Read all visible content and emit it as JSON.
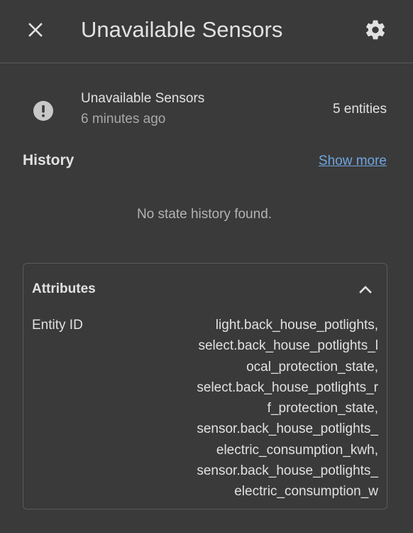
{
  "dialog": {
    "title": "Unavailable Sensors",
    "close_icon": "close-icon",
    "settings_icon": "gear-icon"
  },
  "entity": {
    "icon": "alert-circle-icon",
    "name": "Unavailable Sensors",
    "time": "6 minutes ago",
    "state": "5 entities"
  },
  "history": {
    "title": "History",
    "show_more": "Show more",
    "empty": "No state history found."
  },
  "attributes": {
    "title": "Attributes",
    "chevron_icon": "chevron-up-icon",
    "row": {
      "key": "Entity ID",
      "value_lines": [
        "light.back_house_potlights,",
        "select.back_house_potlights_l",
        "ocal_protection_state,",
        "select.back_house_potlights_r",
        "f_protection_state,",
        "sensor.back_house_potlights_",
        "electric_consumption_kwh,",
        "sensor.back_house_potlights_",
        "electric_consumption_w"
      ]
    }
  },
  "colors": {
    "background": "#3a3a3a",
    "text": "#e1e1e1",
    "secondary_text": "#a8a8a8",
    "link": "#6fa6e0",
    "divider": "#5a5a5a",
    "icon": "#c8c8c8"
  }
}
